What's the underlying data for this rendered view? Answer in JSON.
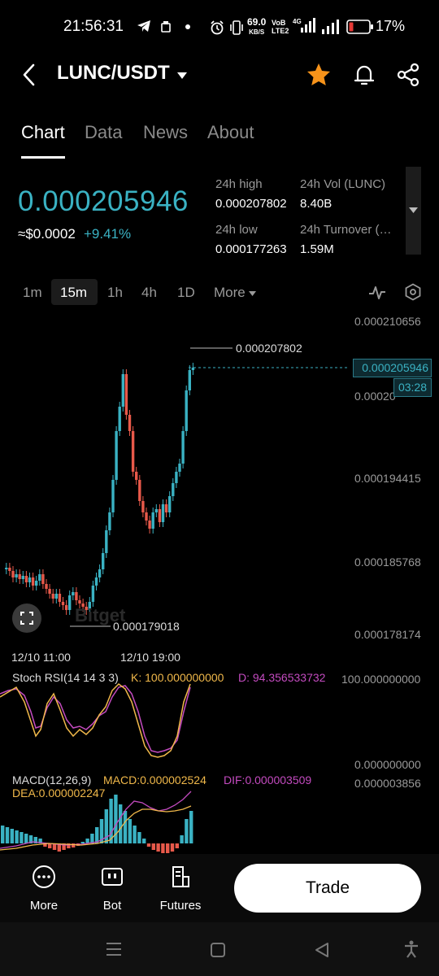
{
  "status_bar": {
    "time": "21:56:31",
    "net_speed": "69.0",
    "net_unit": "KB/S",
    "lte_top": "VoB",
    "lte_bottom": "LTE2",
    "signal": "4G",
    "battery_percent": "17%"
  },
  "header": {
    "pair": "LUNC/USDT",
    "favorite_color": "#f7931a"
  },
  "tabs": [
    {
      "label": "Chart",
      "active": true
    },
    {
      "label": "Data",
      "active": false
    },
    {
      "label": "News",
      "active": false
    },
    {
      "label": "About",
      "active": false
    }
  ],
  "ticker": {
    "last_price": "0.000205946",
    "usd_value": "≈$0.0002",
    "change": "+9.41%",
    "high_label": "24h high",
    "high_value": "0.000207802",
    "vol_label": "24h Vol (LUNC)",
    "vol_value": "8.40B",
    "low_label": "24h low",
    "low_value": "0.000177263",
    "turnover_label": "24h Turnover (…",
    "turnover_value": "1.59M"
  },
  "timeframes": [
    "1m",
    "15m",
    "1h",
    "4h",
    "1D"
  ],
  "timeframe_active": "15m",
  "more_label": "More",
  "price_axis": [
    "0.000210656",
    "0.00020",
    "0.000194415",
    "0.000185768",
    "0.000178174"
  ],
  "current_price_tag": "0.000205946",
  "countdown": "03:28",
  "high_marker": "0.000207802",
  "low_marker": "0.000179018",
  "time_axis": [
    "12/10 11:00",
    "12/10 19:00"
  ],
  "watermark": "Bitget",
  "stoch_rsi": {
    "label": "Stoch RSI(14 14 3 3)",
    "k": "K: 100.000000000",
    "d": "D: 94.356533732",
    "axis_top": "100.000000000",
    "axis_bottom": "0.000000000"
  },
  "macd": {
    "label": "MACD(12,26,9)",
    "macd": "MACD:0.000002524",
    "dif": "DIF:0.000003509",
    "dea": "DEA:0.000002247",
    "axis_top": "0.000003856"
  },
  "bottom_nav": [
    {
      "label": "More",
      "icon": "more-circle-icon"
    },
    {
      "label": "Bot",
      "icon": "bot-icon"
    },
    {
      "label": "Futures",
      "icon": "futures-icon"
    }
  ],
  "trade_button": "Trade",
  "colors": {
    "up": "#3ab2c3",
    "down": "#e8594a",
    "k_line": "#f0b84a",
    "d_line": "#c44bc0"
  },
  "chart_data": {
    "type": "candlestick",
    "title": "",
    "price_range": [
      0.000178174,
      0.000210656
    ],
    "x_labels": [
      "12/10 11:00",
      "12/10 19:00"
    ],
    "high": 0.000207802,
    "low": 0.000179018,
    "last": 0.000205946
  }
}
